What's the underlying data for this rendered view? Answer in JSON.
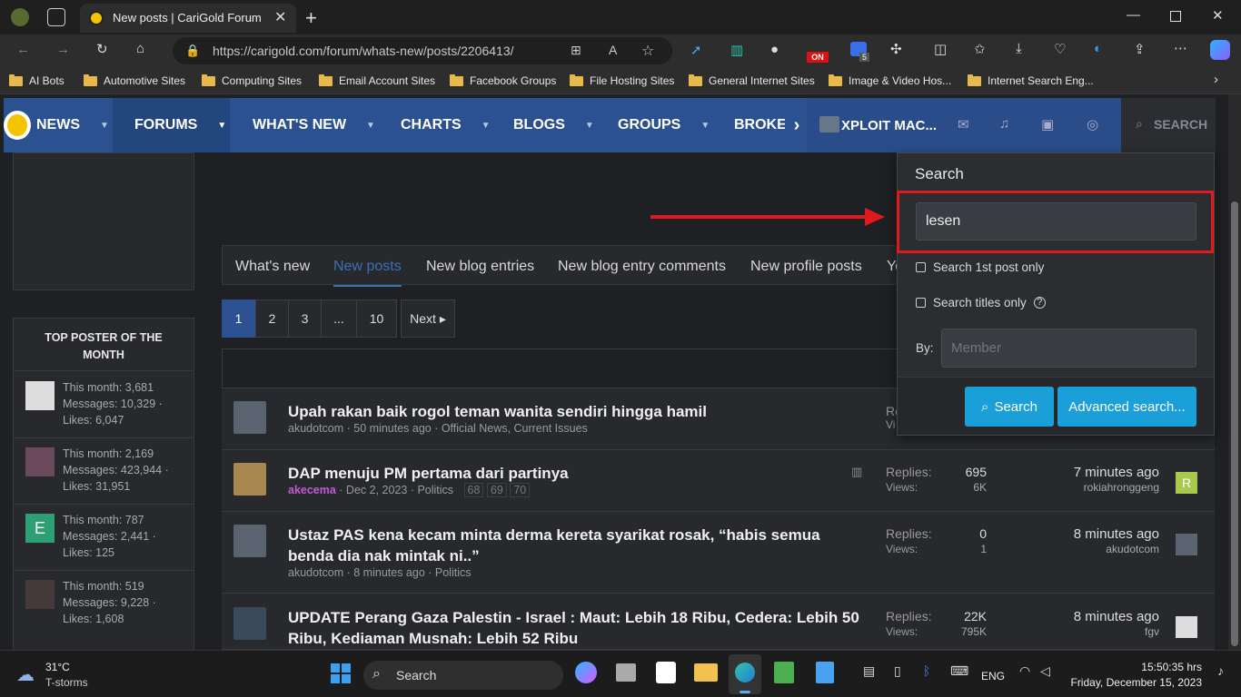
{
  "browser": {
    "tab_title": "New posts | CariGold Forum",
    "url": "https://carigold.com/forum/whats-new/posts/2206413/",
    "bookmarks": [
      "AI Bots",
      "Automotive Sites",
      "Computing Sites",
      "Email Account Sites",
      "Facebook Groups",
      "File Hosting Sites",
      "General Internet Sites",
      "Image & Video Hos...",
      "Internet Search Eng..."
    ],
    "ext_badge": "5",
    "on_badge": "ON"
  },
  "nav": {
    "items": [
      "NEWS",
      "FORUMS",
      "WHAT'S NEW",
      "CHARTS",
      "BLOGS",
      "GROUPS",
      "BROKE"
    ],
    "user": "XPLOIT MAC...",
    "search": "SEARCH"
  },
  "sidebar": {
    "top_poster_title": "TOP POSTER OF THE MONTH",
    "posters": [
      {
        "line1": "This month: 3,681",
        "line2": "Messages: 10,329 ·",
        "line3": "Likes: 6,047"
      },
      {
        "line1": "This month: 2,169",
        "line2": "Messages: 423,944 ·",
        "line3": "Likes: 31,951"
      },
      {
        "line1": "This month: 787",
        "line2": "Messages: 2,441 ·",
        "line3": "Likes: 125",
        "avatar": "E"
      },
      {
        "line1": "This month: 519",
        "line2": "Messages: 9,228 ·",
        "line3": "Likes: 1,608"
      }
    ]
  },
  "tabs": [
    "What's new",
    "New posts",
    "New blog entries",
    "New blog entry comments",
    "New profile posts",
    "Yo"
  ],
  "pagination": [
    "1",
    "2",
    "3",
    "...",
    "10",
    "Next ▸"
  ],
  "threads": [
    {
      "title": "Upah rakan baik rogol teman wanita sendiri hingga hamil",
      "meta": "akudotcom · 50 minutes ago · Official News, Current Issues",
      "replies_label": "Re",
      "views_label": "Vi"
    },
    {
      "title": "DAP menuju PM pertama dari partinya",
      "author": "akecema",
      "meta": " · Dec 2, 2023 · Politics",
      "pages": [
        "68",
        "69",
        "70"
      ],
      "replies_label": "Replies:",
      "replies": "695",
      "views_label": "Views:",
      "views": "6K",
      "last_time": "7 minutes ago",
      "last_user": "rokiahronggeng",
      "last_avatar": "R"
    },
    {
      "title": "Ustaz PAS kena kecam minta derma kereta syarikat rosak, “habis semua benda dia nak mintak ni..”",
      "meta": "akudotcom · 8 minutes ago · Politics",
      "replies_label": "Replies:",
      "replies": "0",
      "views_label": "Views:",
      "views": "1",
      "last_time": "8 minutes ago",
      "last_user": "akudotcom"
    },
    {
      "title": "UPDATE Perang Gaza Palestin - Israel : Maut: Lebih 18 Ribu, Cedera: Lebih 50 Ribu, Kediaman Musnah: Lebih 52 Ribu",
      "replies_label": "Replies:",
      "replies": "22K",
      "views_label": "Views:",
      "views": "795K",
      "last_time": "8 minutes ago",
      "last_user": "fgv"
    }
  ],
  "search_popup": {
    "title": "Search",
    "query": "lesen",
    "opt1": "Search 1st post only",
    "opt2": "Search titles only",
    "by_label": "By:",
    "member_placeholder": "Member",
    "search_button": "Search",
    "advanced_button": "Advanced search..."
  },
  "taskbar": {
    "temp": "31°C",
    "weather": "T-storms",
    "search": "Search",
    "lang": "ENG",
    "time": "15:50:35 hrs",
    "date": "Friday, December 15, 2023"
  },
  "colors": {
    "nav_bg": "#2c5190",
    "accent": "#1b9fd9",
    "highlight": "#e0191e",
    "link_blue": "#3d6fb5",
    "author_purple": "#c25ad6"
  }
}
